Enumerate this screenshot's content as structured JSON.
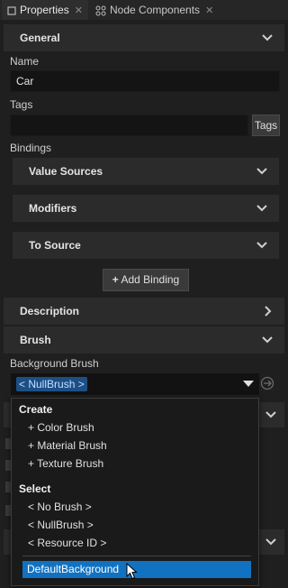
{
  "tabs": [
    {
      "label": "Properties",
      "close": "✕"
    },
    {
      "label": "Node Components",
      "close": "✕"
    }
  ],
  "sections": {
    "general": "General",
    "description": "Description",
    "brush": "Brush"
  },
  "fields": {
    "name_label": "Name",
    "name_value": "Car",
    "tags_label": "Tags",
    "tags_button": "Tags",
    "bindings_label": "Bindings"
  },
  "bindings": {
    "value_sources": "Value Sources",
    "modifiers": "Modifiers",
    "to_source": "To Source",
    "add_binding": "Add Binding"
  },
  "brush": {
    "background_label": "Background Brush",
    "current": "< NullBrush >"
  },
  "dropdown": {
    "create_header": "Create",
    "create_items": [
      "+ Color Brush",
      "+ Material Brush",
      "+ Texture Brush"
    ],
    "select_header": "Select",
    "select_items": [
      "< No Brush >",
      "< NullBrush >",
      "< Resource ID >"
    ],
    "highlighted": "DefaultBackground"
  },
  "colors": {
    "background": "#1f1f1f",
    "section": "#2b2b2b",
    "accent": "#1272c2",
    "tag": "#1d4f86"
  }
}
